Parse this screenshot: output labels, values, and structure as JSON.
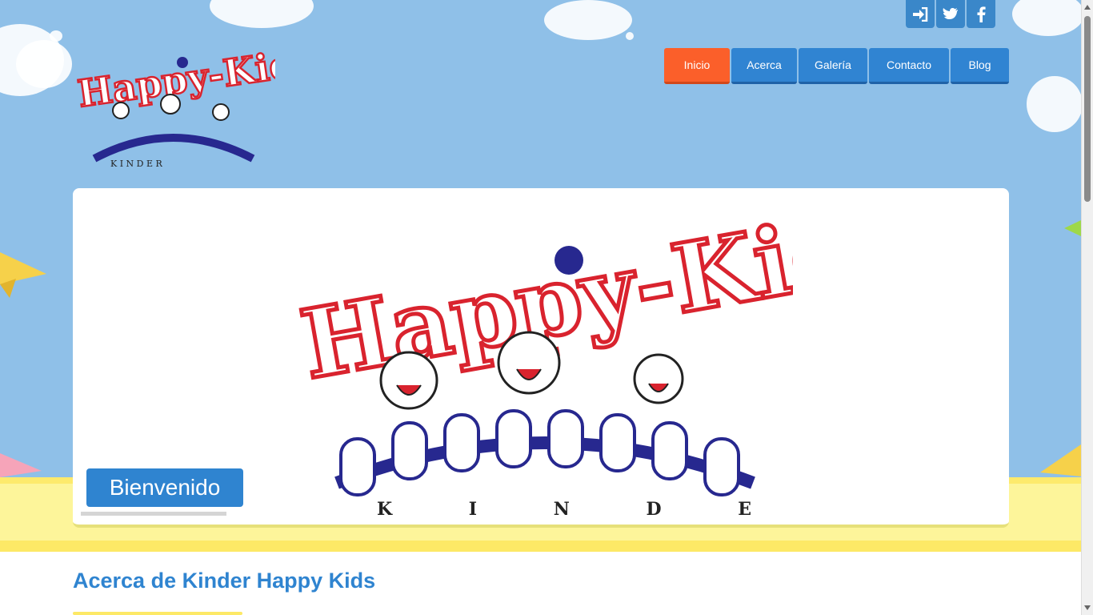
{
  "social": {
    "items": [
      {
        "icon": "login-icon"
      },
      {
        "icon": "twitter-icon"
      },
      {
        "icon": "facebook-icon"
      }
    ]
  },
  "nav": {
    "items": [
      {
        "label": "Inicio",
        "active": true
      },
      {
        "label": "Acerca",
        "active": false
      },
      {
        "label": "Galería",
        "active": false
      },
      {
        "label": "Contacto",
        "active": false
      },
      {
        "label": "Blog",
        "active": false
      }
    ]
  },
  "logo": {
    "text": "Happy-Kids",
    "subtitle": "K I N D E R"
  },
  "hero": {
    "welcome": "Bienvenido"
  },
  "section": {
    "title": "Acerca de Kinder Happy Kids"
  },
  "colors": {
    "sky": "#8fc0e8",
    "nav_blue": "#3084d2",
    "nav_active": "#fb5f2a",
    "yellow": "#fdf59a",
    "logo_red": "#d9232e",
    "logo_navy": "#27288f"
  }
}
